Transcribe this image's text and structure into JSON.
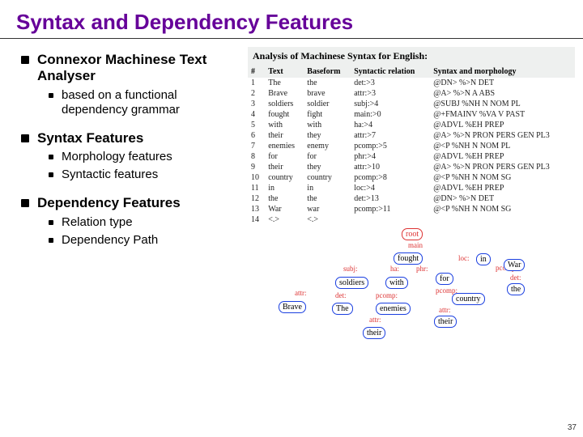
{
  "title": "Syntax and Dependency Features",
  "page_number": "37",
  "bullets": {
    "b1": {
      "head": "Connexor Machinese Text Analyser",
      "sub1": "based on a functional dependency grammar"
    },
    "b2": {
      "head": "Syntax Features",
      "sub1": "Morphology features",
      "sub2": "Syntactic features"
    },
    "b3": {
      "head": "Dependency Features",
      "sub1": "Relation type",
      "sub2": "Dependency Path"
    }
  },
  "syn": {
    "title": "Analysis of Machinese Syntax for English:",
    "cols": {
      "c1": "#",
      "c2": "Text",
      "c3": "Baseform",
      "c4": "Syntactic relation",
      "c5": "Syntax and morphology"
    },
    "rows": [
      {
        "n": "1",
        "t": "The",
        "b": "the",
        "r": "det:>3",
        "m": "@DN> %>N DET"
      },
      {
        "n": "2",
        "t": "Brave",
        "b": "brave",
        "r": "attr:>3",
        "m": "@A> %>N A ABS"
      },
      {
        "n": "3",
        "t": "soldiers",
        "b": "soldier",
        "r": "subj:>4",
        "m": "@SUBJ %NH N NOM PL"
      },
      {
        "n": "4",
        "t": "fought",
        "b": "fight",
        "r": "main:>0",
        "m": "@+FMAINV %VA V PAST"
      },
      {
        "n": "5",
        "t": "with",
        "b": "with",
        "r": "ha:>4",
        "m": "@ADVL %EH PREP"
      },
      {
        "n": "6",
        "t": "their",
        "b": "they",
        "r": "attr:>7",
        "m": "@A> %>N PRON PERS GEN PL3"
      },
      {
        "n": "7",
        "t": "enemies",
        "b": "enemy",
        "r": "pcomp:>5",
        "m": "@<P %NH N NOM PL"
      },
      {
        "n": "8",
        "t": "for",
        "b": "for",
        "r": "phr:>4",
        "m": "@ADVL %EH PREP"
      },
      {
        "n": "9",
        "t": "their",
        "b": "they",
        "r": "attr:>10",
        "m": "@A> %>N PRON PERS GEN PL3"
      },
      {
        "n": "10",
        "t": "country",
        "b": "country",
        "r": "pcomp:>8",
        "m": "@<P %NH N NOM SG"
      },
      {
        "n": "11",
        "t": "in",
        "b": "in",
        "r": "loc:>4",
        "m": "@ADVL %EH PREP"
      },
      {
        "n": "12",
        "t": "the",
        "b": "the",
        "r": "det:>13",
        "m": "@DN> %>N DET"
      },
      {
        "n": "13",
        "t": "War",
        "b": "war",
        "r": "pcomp:>11",
        "m": "@<P %NH N NOM SG"
      },
      {
        "n": "14",
        "t": "<.>",
        "b": "<.>",
        "r": "",
        "m": ""
      }
    ]
  },
  "dep": {
    "nodes": {
      "root": "root",
      "fought": "fought",
      "soldiers": "soldiers",
      "with": "with",
      "for": "for",
      "in": "in",
      "brave": "Brave",
      "the1": "The",
      "enemies": "enemies",
      "their1": "their",
      "country": "country",
      "their2": "their",
      "war": "War",
      "the2": "the"
    },
    "labels": {
      "main": "main",
      "subj": "subj:",
      "ha": "ha:",
      "phr": "phr:",
      "loc": "loc:",
      "attr1": "attr:",
      "det1": "det:",
      "pcomp1": "pcomp:",
      "pcomp2": "pcomp:",
      "attr2": "attr:",
      "attr3": "attr:",
      "pcomp3": "pcomp:",
      "det2": "det:"
    }
  }
}
